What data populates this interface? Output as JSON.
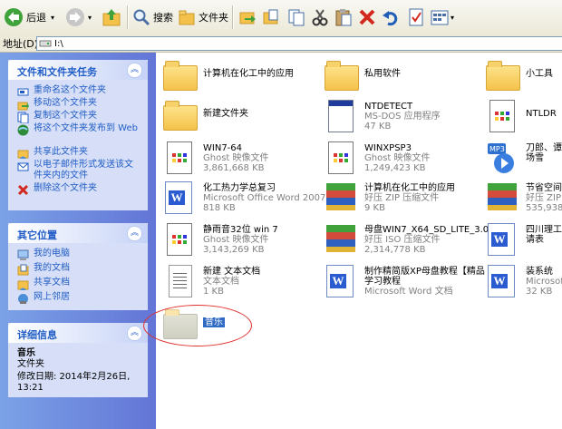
{
  "toolbar": {
    "back_label": "后退",
    "search_label": "搜索",
    "folders_label": "文件夹"
  },
  "address": {
    "label": "地址(D)",
    "path": "I:\\"
  },
  "tasks_panel": {
    "title": "文件和文件夹任务",
    "items": [
      {
        "label": "重命名这个文件夹",
        "icon": "rename-icon"
      },
      {
        "label": "移动这个文件夹",
        "icon": "move-icon"
      },
      {
        "label": "复制这个文件夹",
        "icon": "copy-icon"
      },
      {
        "label": "将这个文件夹发布到 Web",
        "icon": "publish-web-icon"
      },
      {
        "label": "共享此文件夹",
        "icon": "share-icon"
      },
      {
        "label": "以电子邮件形式发送该文件夹内的文件",
        "icon": "email-icon"
      },
      {
        "label": "删除这个文件夹",
        "icon": "delete-icon"
      }
    ]
  },
  "other_places": {
    "title": "其它位置",
    "items": [
      {
        "label": "我的电脑",
        "icon": "my-computer-icon"
      },
      {
        "label": "我的文档",
        "icon": "my-documents-icon"
      },
      {
        "label": "共享文档",
        "icon": "shared-docs-icon"
      },
      {
        "label": "网上邻居",
        "icon": "network-icon"
      }
    ]
  },
  "details": {
    "title": "详细信息",
    "name": "音乐",
    "type": "文件夹",
    "modified": "修改日期: 2014年2月26日, 13:21"
  },
  "files": [
    {
      "name": "计算机在化工中的应用",
      "type": "",
      "size": "",
      "icon": "folder"
    },
    {
      "name": "私用软件",
      "type": "",
      "size": "",
      "icon": "folder"
    },
    {
      "name": "小工具",
      "type": "",
      "size": "",
      "icon": "folder"
    },
    {
      "name": "新建文件夹",
      "type": "",
      "size": "",
      "icon": "folder"
    },
    {
      "name": "NTDETECT",
      "type": "MS-DOS 应用程序",
      "size": "47 KB",
      "icon": "msdos"
    },
    {
      "name": "NTLDR",
      "type": "",
      "size": "",
      "icon": "ghost"
    },
    {
      "name": "WIN7-64",
      "type": "Ghost 映像文件",
      "size": "3,861,668 KB",
      "icon": "ghost"
    },
    {
      "name": "WINXPSP3",
      "type": "Ghost 映像文件",
      "size": "1,249,423 KB",
      "icon": "ghost"
    },
    {
      "name": "刀郎、谭",
      "type": "场雪",
      "size": "",
      "icon": "mp3"
    },
    {
      "name": "化工热力学总复习",
      "type": "Microsoft Office Word 2007 ...",
      "size": "818 KB",
      "icon": "word"
    },
    {
      "name": "计算机在化工中的应用",
      "type": "好压 ZIP 压缩文件",
      "size": "9 KB",
      "icon": "zip"
    },
    {
      "name": "节省空间",
      "type": "好压 ZIP",
      "size": "535,938 K",
      "icon": "zip"
    },
    {
      "name": "静雨音32位 win 7",
      "type": "Ghost 映像文件",
      "size": "3,143,269 KB",
      "icon": "ghost"
    },
    {
      "name": "母盘WIN7_X64_SD_LITE_3.0",
      "type": "好压 ISO 压缩文件",
      "size": "2,314,778 KB",
      "icon": "zip"
    },
    {
      "name": "四川理工",
      "type": "请表",
      "size": "",
      "icon": "word"
    },
    {
      "name": "新建 文本文档",
      "type": "文本文档",
      "size": "1 KB",
      "icon": "text"
    },
    {
      "name": "制作精简版XP母盘教程【精品",
      "type": "学习教程",
      "size": "Microsoft Word 文档",
      "icon": "word"
    },
    {
      "name": "装系统",
      "type": "Microsoft",
      "size": "32 KB",
      "icon": "word"
    },
    {
      "name": "音乐",
      "type": "",
      "size": "",
      "icon": "folder"
    }
  ],
  "colors": {
    "sidebar_link": "#215dc6",
    "selection": "#316ac5",
    "annotation": "#e0302d"
  }
}
